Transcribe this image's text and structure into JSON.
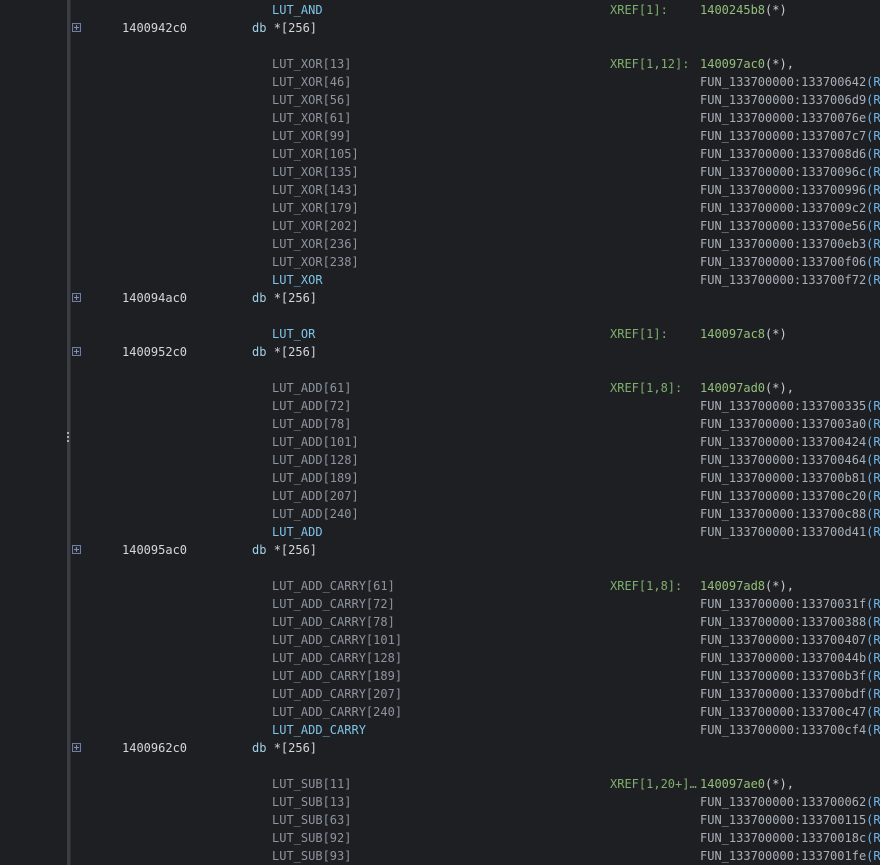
{
  "listing": {
    "rows": [
      {
        "label": "LUT_AND",
        "label_style": "main",
        "xref": "XREF[1]:",
        "ref": "1400245b8",
        "ref_suffix": "(*)",
        "ref_style": "green"
      },
      {
        "expand": true,
        "address": "1400942c0",
        "mnemonic": "db",
        "operand": "*[256]"
      },
      {
        "blank": true
      },
      {
        "label": "LUT_XOR[13]",
        "label_style": "dim",
        "xref": "XREF[1,12]:",
        "ref": "140097ac0",
        "ref_suffix": "(*),",
        "ref_style": "green"
      },
      {
        "label": "LUT_XOR[46]",
        "label_style": "dim",
        "ref": "FUN_133700000:133700642",
        "ref_r": "(R)"
      },
      {
        "label": "LUT_XOR[56]",
        "label_style": "dim",
        "ref": "FUN_133700000:1337006d9",
        "ref_r": "(R)"
      },
      {
        "label": "LUT_XOR[61]",
        "label_style": "dim",
        "ref": "FUN_133700000:13370076e",
        "ref_r": "(R)"
      },
      {
        "label": "LUT_XOR[99]",
        "label_style": "dim",
        "ref": "FUN_133700000:1337007c7",
        "ref_r": "(R)"
      },
      {
        "label": "LUT_XOR[105]",
        "label_style": "dim",
        "ref": "FUN_133700000:1337008d6",
        "ref_r": "(R)"
      },
      {
        "label": "LUT_XOR[135]",
        "label_style": "dim",
        "ref": "FUN_133700000:13370096c",
        "ref_r": "(R)"
      },
      {
        "label": "LUT_XOR[143]",
        "label_style": "dim",
        "ref": "FUN_133700000:133700996",
        "ref_r": "(R)"
      },
      {
        "label": "LUT_XOR[179]",
        "label_style": "dim",
        "ref": "FUN_133700000:1337009c2",
        "ref_r": "(R)"
      },
      {
        "label": "LUT_XOR[202]",
        "label_style": "dim",
        "ref": "FUN_133700000:133700e56",
        "ref_r": "(R)"
      },
      {
        "label": "LUT_XOR[236]",
        "label_style": "dim",
        "ref": "FUN_133700000:133700eb3",
        "ref_r": "(R)"
      },
      {
        "label": "LUT_XOR[238]",
        "label_style": "dim",
        "ref": "FUN_133700000:133700f06",
        "ref_r": "(R)"
      },
      {
        "label": "LUT_XOR",
        "label_style": "main",
        "ref": "FUN_133700000:133700f72",
        "ref_r": "(R)"
      },
      {
        "expand": true,
        "address": "140094ac0",
        "mnemonic": "db",
        "operand": "*[256]"
      },
      {
        "blank": true
      },
      {
        "label": "LUT_OR",
        "label_style": "main",
        "xref": "XREF[1]:",
        "ref": "140097ac8",
        "ref_suffix": "(*)",
        "ref_style": "green"
      },
      {
        "expand": true,
        "address": "1400952c0",
        "mnemonic": "db",
        "operand": "*[256]"
      },
      {
        "blank": true
      },
      {
        "label": "LUT_ADD[61]",
        "label_style": "dim",
        "xref": "XREF[1,8]:",
        "ref": "140097ad0",
        "ref_suffix": "(*),",
        "ref_style": "green"
      },
      {
        "label": "LUT_ADD[72]",
        "label_style": "dim",
        "ref": "FUN_133700000:133700335",
        "ref_r": "(R)"
      },
      {
        "label": "LUT_ADD[78]",
        "label_style": "dim",
        "ref": "FUN_133700000:1337003a0",
        "ref_r": "(R)"
      },
      {
        "label": "LUT_ADD[101]",
        "label_style": "dim",
        "ref": "FUN_133700000:133700424",
        "ref_r": "(R)"
      },
      {
        "label": "LUT_ADD[128]",
        "label_style": "dim",
        "ref": "FUN_133700000:133700464",
        "ref_r": "(R)"
      },
      {
        "label": "LUT_ADD[189]",
        "label_style": "dim",
        "ref": "FUN_133700000:133700b81",
        "ref_r": "(R)"
      },
      {
        "label": "LUT_ADD[207]",
        "label_style": "dim",
        "ref": "FUN_133700000:133700c20",
        "ref_r": "(R)"
      },
      {
        "label": "LUT_ADD[240]",
        "label_style": "dim",
        "ref": "FUN_133700000:133700c88",
        "ref_r": "(R)"
      },
      {
        "label": "LUT_ADD",
        "label_style": "main",
        "ref": "FUN_133700000:133700d41",
        "ref_r": "(R)"
      },
      {
        "expand": true,
        "address": "140095ac0",
        "mnemonic": "db",
        "operand": "*[256]"
      },
      {
        "blank": true
      },
      {
        "label": "LUT_ADD_CARRY[61]",
        "label_style": "dim",
        "xref": "XREF[1,8]:",
        "ref": "140097ad8",
        "ref_suffix": "(*),",
        "ref_style": "green"
      },
      {
        "label": "LUT_ADD_CARRY[72]",
        "label_style": "dim",
        "ref": "FUN_133700000:13370031f",
        "ref_r": "(R)"
      },
      {
        "label": "LUT_ADD_CARRY[78]",
        "label_style": "dim",
        "ref": "FUN_133700000:133700388",
        "ref_r": "(R)"
      },
      {
        "label": "LUT_ADD_CARRY[101]",
        "label_style": "dim",
        "ref": "FUN_133700000:133700407",
        "ref_r": "(R)"
      },
      {
        "label": "LUT_ADD_CARRY[128]",
        "label_style": "dim",
        "ref": "FUN_133700000:13370044b",
        "ref_r": "(R)"
      },
      {
        "label": "LUT_ADD_CARRY[189]",
        "label_style": "dim",
        "ref": "FUN_133700000:133700b3f",
        "ref_r": "(R)"
      },
      {
        "label": "LUT_ADD_CARRY[207]",
        "label_style": "dim",
        "ref": "FUN_133700000:133700bdf",
        "ref_r": "(R)"
      },
      {
        "label": "LUT_ADD_CARRY[240]",
        "label_style": "dim",
        "ref": "FUN_133700000:133700c47",
        "ref_r": "(R)"
      },
      {
        "label": "LUT_ADD_CARRY",
        "label_style": "main",
        "ref": "FUN_133700000:133700cf4",
        "ref_r": "(R)"
      },
      {
        "expand": true,
        "address": "1400962c0",
        "mnemonic": "db",
        "operand": "*[256]"
      },
      {
        "blank": true
      },
      {
        "label": "LUT_SUB[11]",
        "label_style": "dim",
        "xref": "XREF[1,20+]…",
        "ref": "140097ae0",
        "ref_suffix": "(*),",
        "ref_style": "green"
      },
      {
        "label": "LUT_SUB[13]",
        "label_style": "dim",
        "ref": "FUN_133700000:133700062",
        "ref_r": "(R)"
      },
      {
        "label": "LUT_SUB[63]",
        "label_style": "dim",
        "ref": "FUN_133700000:133700115",
        "ref_r": "(R)"
      },
      {
        "label": "LUT_SUB[92]",
        "label_style": "dim",
        "ref": "FUN_133700000:13370018c",
        "ref_r": "(R)"
      },
      {
        "label": "LUT_SUB[93]",
        "label_style": "dim",
        "ref": "FUN_133700000:1337001fe",
        "ref_r": "(R)"
      }
    ]
  }
}
